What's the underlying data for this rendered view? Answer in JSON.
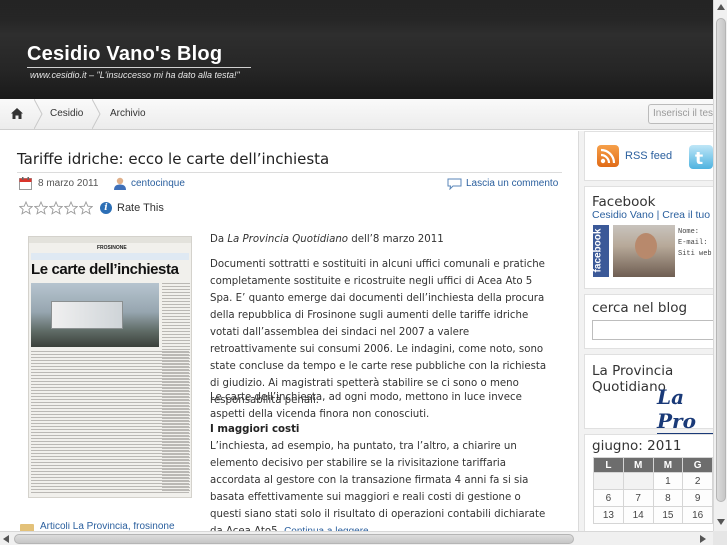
{
  "header": {
    "title": "Cesidio Vano's Blog",
    "tagline": "www.cesidio.it – \"L'insuccesso mi ha dato alla testa!\""
  },
  "nav": {
    "items": [
      "Cesidio",
      "Archivio"
    ],
    "search_placeholder": "Inserisci il testo"
  },
  "post": {
    "title": "Tariffe idriche: ecco le carte dell’inchiesta",
    "date": "8 marzo 2011",
    "author": "centocinque",
    "comment_link": "Lascia un commento",
    "rate_label": "Rate This",
    "rating": 0,
    "rating_max": 5,
    "from_prefix": "Da ",
    "from_source": "La Provincia Quotidiano",
    "from_suffix": " dell’8 marzo 2011",
    "paragraph_1": "Documenti sottratti e sostituiti in alcuni uffici comunali e pratiche completamente sostituite e ricostruite negli uffici di Acea Ato 5 Spa. E’ quanto emerge dai documenti dell’inchiesta della procura della repubblica di Frosinone sugli aumenti delle tariffe idriche votati dall’assemblea dei sindaci nel 2007 a valere retroattivamente sui consumi 2006. Le indagini, come noto, sono state concluse da tempo e le carte rese pubbliche con la richiesta di giudizio. Ai magistrati spetterà stabilire se ci sono o meno responsabilità penali.",
    "paragraph_2": "Le carte dell’inchiesta, ad ogni modo, mettono in luce invece aspetti della vicenda finora non conosciuti.",
    "subheading": "I maggiori costi",
    "paragraph_3": "L’inchiesta, ad esempio, ha puntato, tra l’altro, a chiarire un elemento decisivo per stabilire se la rivisitazione tariffaria accordata al gestore con la transazione firmata 4 anni fa si sia basata effettivamente sui maggiori e reali costi di gestione o questi siano stati solo il risultato di operazioni contabili dichiarate da Acea Ato5.",
    "continue_link": "Continua a leggere…",
    "tags": "Articoli La Provincia, frosinone",
    "clipping": {
      "section": "FROSINONE",
      "headline": "Le carte dell’inchiesta"
    }
  },
  "sidebar": {
    "rss_label": "RSS feed",
    "facebook_title": "Facebook",
    "facebook_links": "Cesidio Vano | Crea il tuo",
    "facebook_badge": "facebook",
    "facebook_fields": "Nome:\nE-mail:\nSiti web:",
    "search_title": "cerca nel blog",
    "provincia_title": "La Provincia Quotidiano",
    "provincia_logo": "La Pro",
    "calendar": {
      "title": "giugno: 2011",
      "headers": [
        "L",
        "M",
        "M",
        "G"
      ],
      "rows": [
        [
          "",
          "",
          "1",
          "2"
        ],
        [
          "6",
          "7",
          "8",
          "9"
        ],
        [
          "13",
          "14",
          "15",
          "16"
        ]
      ]
    }
  },
  "colors": {
    "link": "#2a5f9e",
    "header_bg": "#262626",
    "calendar_header": "#6d6d6d"
  }
}
